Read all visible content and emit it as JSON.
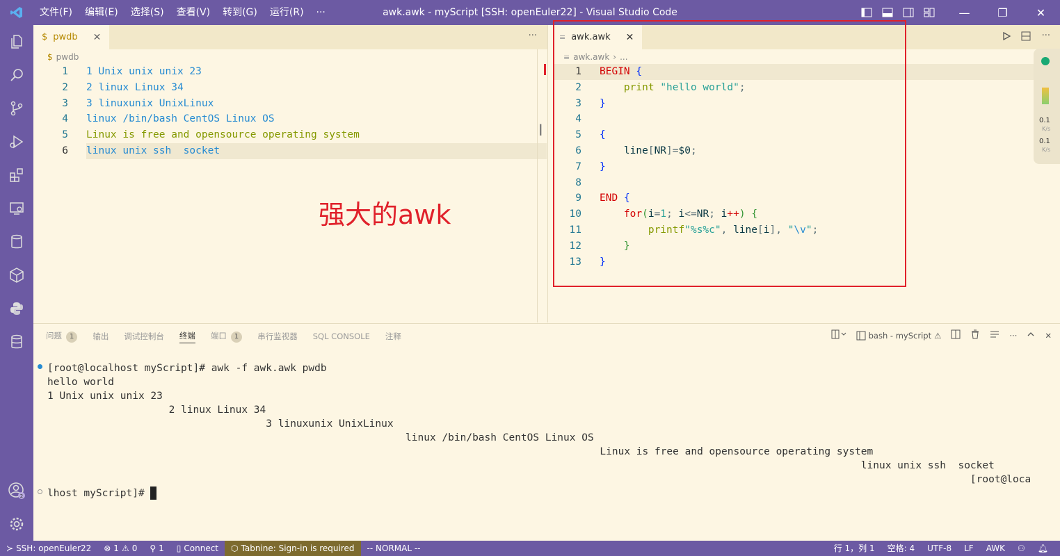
{
  "titlebar": {
    "menu": [
      "文件(F)",
      "编辑(E)",
      "选择(S)",
      "查看(V)",
      "转到(G)",
      "运行(R)",
      "···"
    ],
    "title": "awk.awk - myScript [SSH: openEuler22] - Visual Studio Code"
  },
  "left_editor": {
    "tab": "pwdb",
    "breadcrumb": "pwdb",
    "lines": [
      "1 Unix unix unix 23",
      "2 linux Linux 34",
      "3 linuxunix UnixLinux",
      "linux /bin/bash CentOS Linux OS",
      "Linux is free and opensource operating system",
      "linux unix ssh  socket"
    ]
  },
  "right_editor": {
    "tab": "awk.awk",
    "breadcrumb": [
      "awk.awk",
      "..."
    ],
    "line_numbers": [
      "1",
      "2",
      "3",
      "4",
      "5",
      "6",
      "7",
      "8",
      "9",
      "10",
      "11",
      "12",
      "13"
    ]
  },
  "overlay_text": "强大的awk",
  "right_meters": [
    "0.1",
    "K/s",
    "0.1",
    "K/s"
  ],
  "panel": {
    "tabs": [
      {
        "label": "问题",
        "badge": "1"
      },
      {
        "label": "输出"
      },
      {
        "label": "调试控制台"
      },
      {
        "label": "终端",
        "active": true
      },
      {
        "label": "端口",
        "badge": "1"
      },
      {
        "label": "串行监视器"
      },
      {
        "label": "SQL CONSOLE"
      },
      {
        "label": "注释"
      }
    ],
    "terminal_name": "bash - myScript",
    "terminal_lines": [
      "[root@localhost myScript]# awk -f awk.awk pwdb",
      "hello world",
      "1 Unix unix unix 23",
      "                    2 linux Linux 34",
      "                                    3 linuxunix UnixLinux",
      "                                                           linux /bin/bash CentOS Linux OS",
      "                                                                                           Linux is free and opensource operating system",
      "                                                                                                                                      linux unix ssh  socket",
      "                                                                                                                                                        [root@loca",
      "lhost myScript]# "
    ]
  },
  "statusbar": {
    "remote": "SSH: openEuler22",
    "errors": "1",
    "warnings": "0",
    "ports": "1",
    "connect": "Connect",
    "tabnine": "Tabnine: Sign-in is required",
    "mode": "-- NORMAL --",
    "position": "行 1，列 1",
    "spaces": "空格: 4",
    "encoding": "UTF-8",
    "eol": "LF",
    "language": "AWK"
  }
}
